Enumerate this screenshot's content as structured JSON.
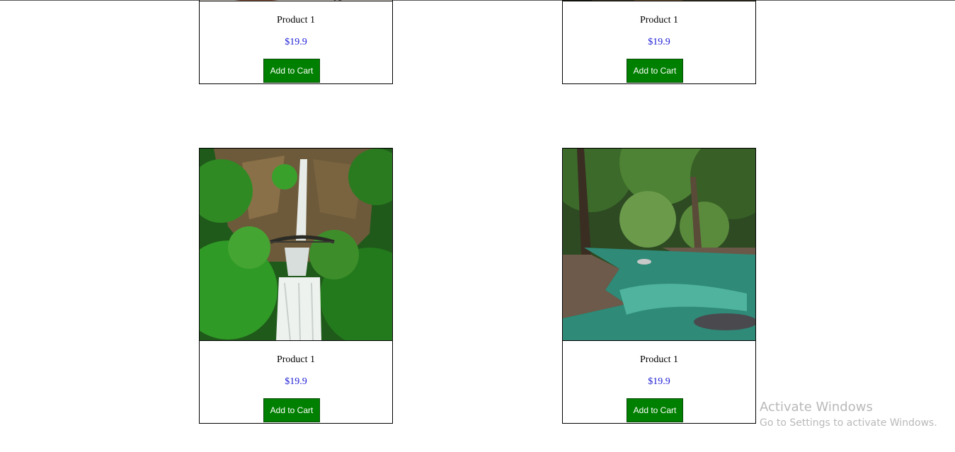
{
  "products": [
    {
      "name": "Product 1",
      "price": "$19.9",
      "button": "Add to Cart",
      "image": "table-bowl-photo"
    },
    {
      "name": "Product 1",
      "price": "$19.9",
      "button": "Add to Cart",
      "image": "forest-path-photo"
    },
    {
      "name": "Product 1",
      "price": "$19.9",
      "button": "Add to Cart",
      "image": "waterfall-bridge-photo"
    },
    {
      "name": "Product 1",
      "price": "$19.9",
      "button": "Add to Cart",
      "image": "forest-river-photo"
    }
  ],
  "watermark": {
    "title": "Activate Windows",
    "subtitle": "Go to Settings to activate Windows."
  },
  "colors": {
    "button_bg": "#008000",
    "price": "#1b1bd6"
  }
}
